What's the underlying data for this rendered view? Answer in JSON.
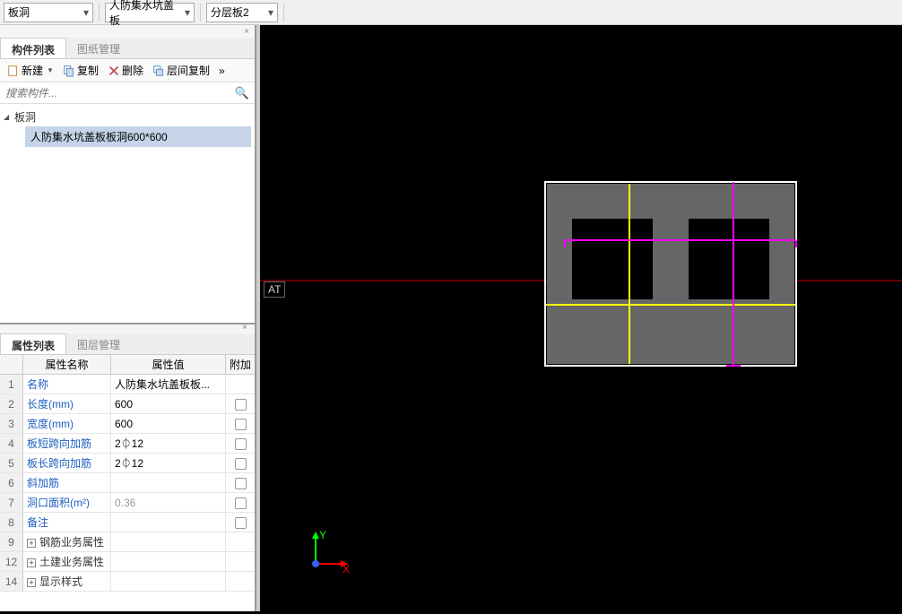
{
  "topbar": {
    "dropdown1": "板洞",
    "dropdown2": "人防集水坑盖板",
    "dropdown3": "分层板2"
  },
  "componentPanel": {
    "tabs": {
      "components": "构件列表",
      "drawings": "图纸管理"
    },
    "toolbar": {
      "new": "新建",
      "copy": "复制",
      "delete": "删除",
      "layerCopy": "层间复制",
      "more": "»"
    },
    "searchPlaceholder": "搜索构件...",
    "tree": {
      "root": "板洞",
      "child": "人防集水坑盖板板洞600*600"
    }
  },
  "propertyPanel": {
    "tabs": {
      "properties": "属性列表",
      "layers": "图层管理"
    },
    "headers": {
      "name": "属性名称",
      "value": "属性值",
      "extra": "附加"
    },
    "rows": [
      {
        "num": "1",
        "name": "名称",
        "value": "人防集水坑盖板板...",
        "check": false,
        "nameClass": ""
      },
      {
        "num": "2",
        "name": "长度(mm)",
        "value": "600",
        "check": true,
        "nameClass": ""
      },
      {
        "num": "3",
        "name": "宽度(mm)",
        "value": "600",
        "check": true,
        "nameClass": ""
      },
      {
        "num": "4",
        "name": "板短跨向加筋",
        "value": "2⏀12",
        "check": true,
        "nameClass": ""
      },
      {
        "num": "5",
        "name": "板长跨向加筋",
        "value": "2⏀12",
        "check": true,
        "nameClass": ""
      },
      {
        "num": "6",
        "name": "斜加筋",
        "value": "",
        "check": true,
        "nameClass": ""
      },
      {
        "num": "7",
        "name": "洞口面积(m²)",
        "value": "0.36",
        "check": true,
        "valueGray": true,
        "nameClass": ""
      },
      {
        "num": "8",
        "name": "备注",
        "value": "",
        "check": true,
        "nameClass": ""
      },
      {
        "num": "9",
        "name": "钢筋业务属性",
        "value": "",
        "expandable": true,
        "nameClass": "black"
      },
      {
        "num": "12",
        "name": "土建业务属性",
        "value": "",
        "expandable": true,
        "nameClass": "black"
      },
      {
        "num": "14",
        "name": "显示样式",
        "value": "",
        "expandable": true,
        "nameClass": "black"
      }
    ]
  },
  "viewport": {
    "atLabel": "AT",
    "axisX": "X",
    "axisY": "Y"
  }
}
